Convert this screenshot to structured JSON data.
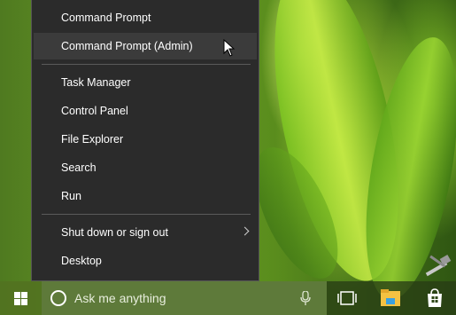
{
  "context_menu": {
    "items": [
      {
        "label": "Command Prompt"
      },
      {
        "label": "Command Prompt (Admin)"
      },
      {
        "label": "Task Manager"
      },
      {
        "label": "Control Panel"
      },
      {
        "label": "File Explorer"
      },
      {
        "label": "Search"
      },
      {
        "label": "Run"
      },
      {
        "label": "Shut down or sign out"
      },
      {
        "label": "Desktop"
      }
    ],
    "hovered_item": "Command Prompt (Admin)"
  },
  "taskbar": {
    "search_placeholder": "Ask me anything",
    "icons": [
      "windows-logo-icon",
      "cortana-icon",
      "microphone-icon",
      "task-view-icon",
      "file-explorer-icon",
      "store-icon"
    ]
  },
  "colors": {
    "menu_bg": "#2b2b2b",
    "menu_hover": "#3b3b3b",
    "menu_text": "#ffffff",
    "taskbar_bg": "#2e4716",
    "search_bg": "#5e7a3a"
  }
}
